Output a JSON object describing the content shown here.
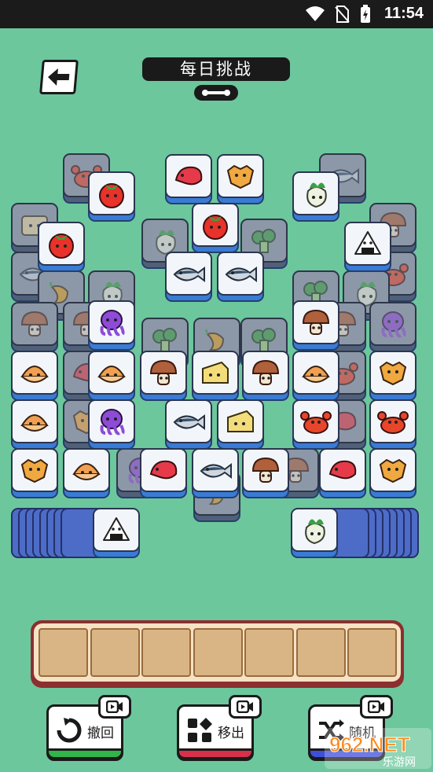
{
  "status_bar": {
    "time": "11:54"
  },
  "header": {
    "title": "每日挑战",
    "back_icon": "arrow-left-icon"
  },
  "tools": [
    {
      "label": "撤回",
      "icon": "undo-icon",
      "bar_color": "#2fb54a"
    },
    {
      "label": "移出",
      "icon": "move-out-icon",
      "bar_color": "#d8304b"
    },
    {
      "label": "随机",
      "icon": "shuffle-icon",
      "bar_color": "#3f4fd8"
    }
  ],
  "watermark": {
    "brand": "962.NET",
    "sub": "乐游网"
  },
  "tray": {
    "slots": 7,
    "filled": 0
  },
  "tile_types": [
    "tomato",
    "fish",
    "shrimp",
    "radish",
    "crab",
    "onigiri",
    "pepper",
    "broccoli",
    "octopus",
    "mushroom",
    "clam",
    "cheese",
    "cracker",
    "bread"
  ]
}
